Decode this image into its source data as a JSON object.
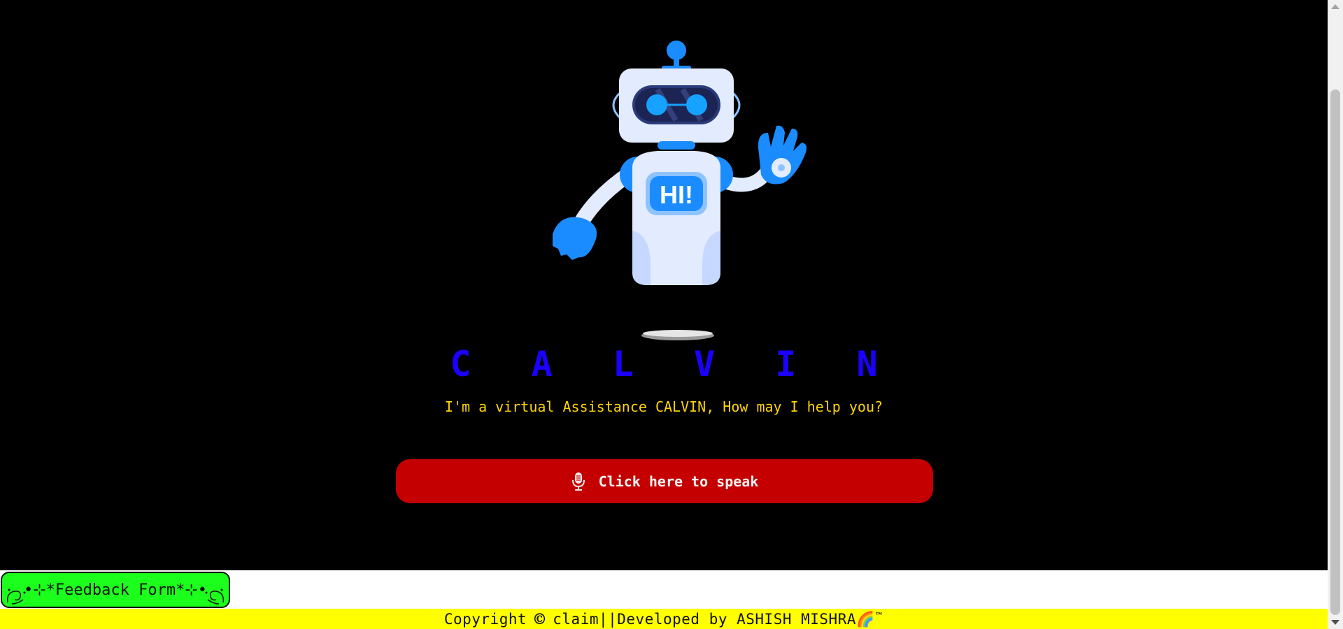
{
  "assistant": {
    "robot_badge": "HI!",
    "name": "C A L V I N",
    "tagline": "I'm a virtual Assistance CALVIN, How may I help you?"
  },
  "speak_button": {
    "icon": "microphone-icon",
    "label": "Click here to speak"
  },
  "feedback": {
    "label": "•⊹*Feedback Form*⊹•"
  },
  "footer": {
    "prefix": "Copyright",
    "copy_symbol": "©",
    "text": "claim||Developed by ASHISH MISHRA",
    "rainbow": "🌈",
    "trademark": "™"
  },
  "colors": {
    "background": "#000000",
    "title": "#1b00ff",
    "tagline": "#ffd400",
    "button": "#c40000",
    "feedback": "#1cff1c",
    "footer": "#ffff00"
  }
}
